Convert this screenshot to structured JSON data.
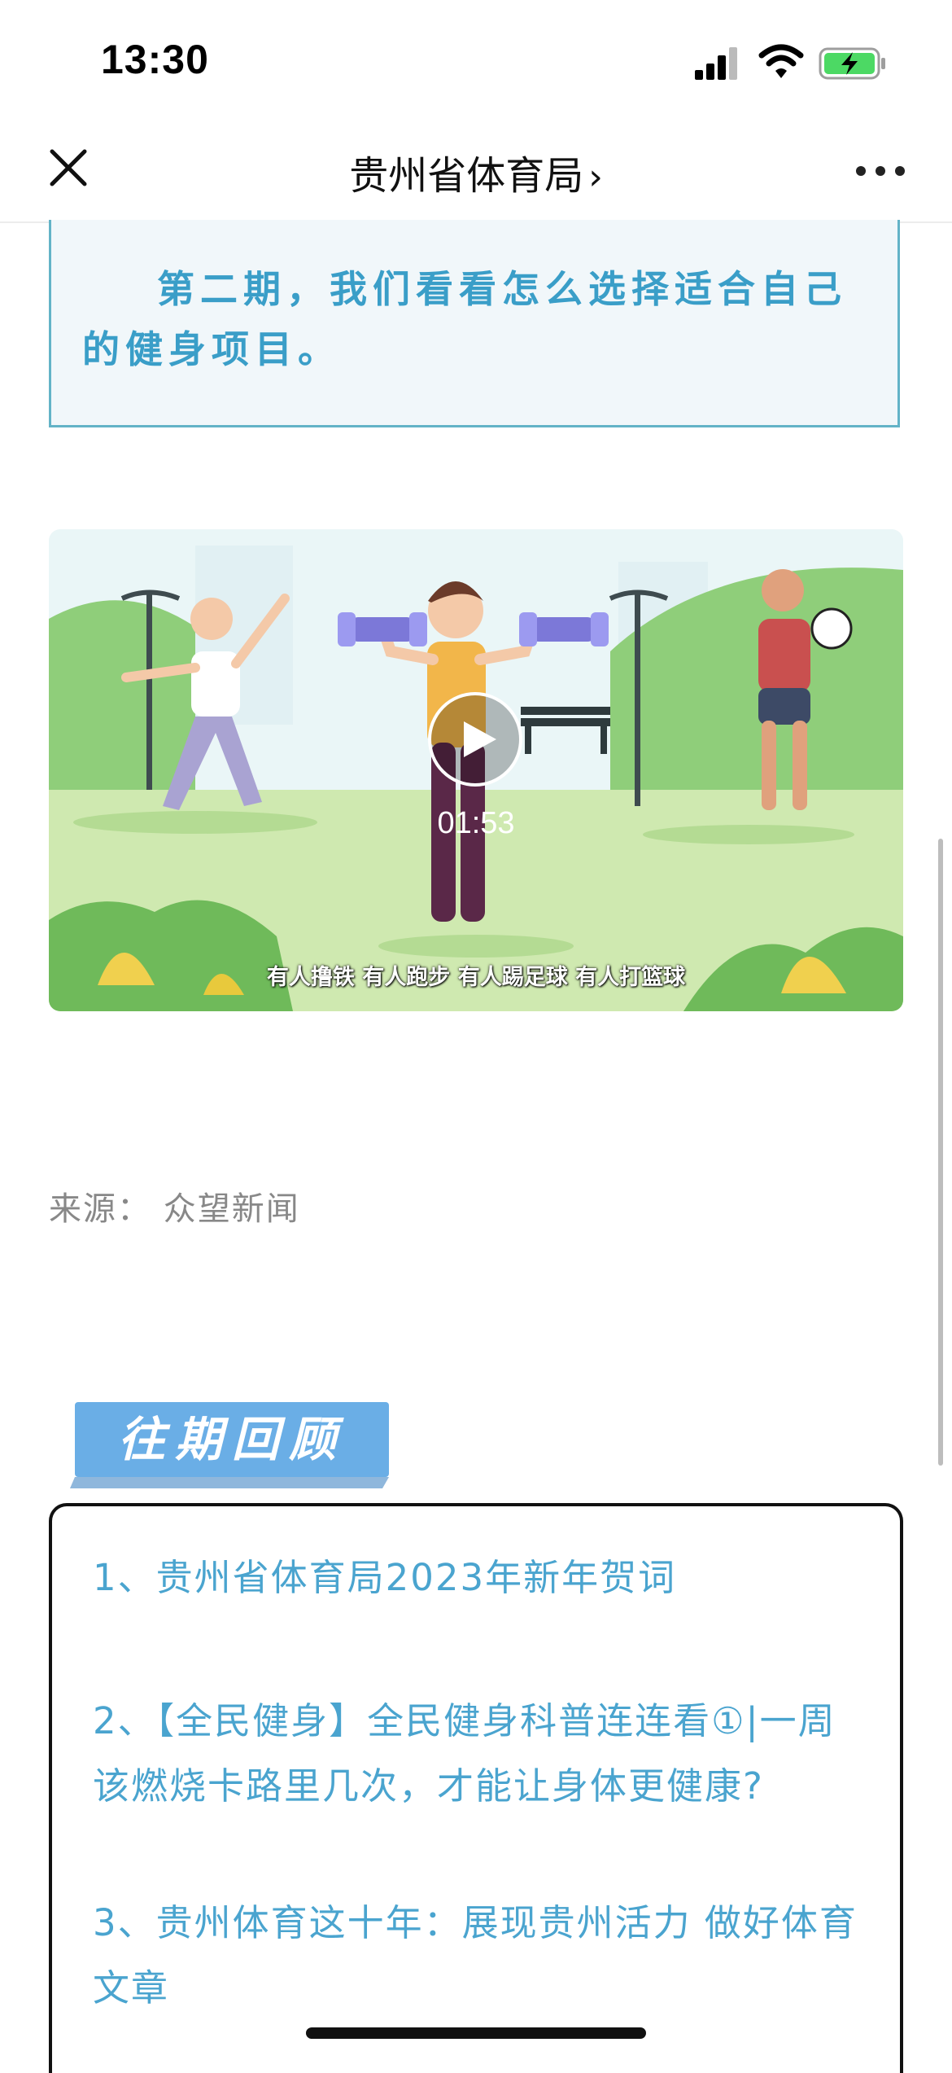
{
  "status_bar": {
    "time": "13:30"
  },
  "nav": {
    "title": "贵州省体育局",
    "chevron": "›"
  },
  "article": {
    "intro": "第二期，我们看看怎么选择适合自己的健身项目。",
    "video": {
      "duration": "01:53",
      "subtitle": "有人撸铁 有人跑步 有人踢足球 有人打篮球"
    },
    "source": "来源：  众望新闻"
  },
  "past_issues": {
    "header": "往期回顾",
    "items": [
      "1、贵州省体育局2023年新年贺词",
      "2、【全民健身】全民健身科普连连看①|一周该燃烧卡路里几次，才能让身体更健康?",
      "3、贵州体育这十年：展现贵州活力 做好体育文章"
    ]
  },
  "colors": {
    "accent_blue": "#4aa4cf",
    "intro_text": "#3a9ec8",
    "intro_border": "#63b3c7",
    "header_blue": "#6aaee6"
  },
  "icons": [
    "signal-icon",
    "wifi-icon",
    "battery-icon",
    "close-icon",
    "chevron-right-icon",
    "more-icon",
    "play-icon"
  ]
}
